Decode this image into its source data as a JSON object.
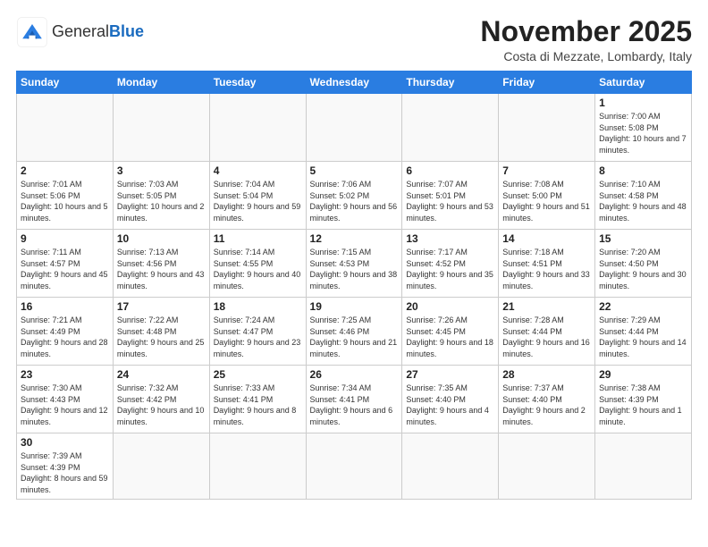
{
  "header": {
    "logo": {
      "general": "General",
      "blue": "Blue"
    },
    "title": "November 2025",
    "location": "Costa di Mezzate, Lombardy, Italy"
  },
  "days_of_week": [
    "Sunday",
    "Monday",
    "Tuesday",
    "Wednesday",
    "Thursday",
    "Friday",
    "Saturday"
  ],
  "weeks": [
    [
      {
        "day": "",
        "info": ""
      },
      {
        "day": "",
        "info": ""
      },
      {
        "day": "",
        "info": ""
      },
      {
        "day": "",
        "info": ""
      },
      {
        "day": "",
        "info": ""
      },
      {
        "day": "",
        "info": ""
      },
      {
        "day": "1",
        "info": "Sunrise: 7:00 AM\nSunset: 5:08 PM\nDaylight: 10 hours and 7 minutes."
      }
    ],
    [
      {
        "day": "2",
        "info": "Sunrise: 7:01 AM\nSunset: 5:06 PM\nDaylight: 10 hours and 5 minutes."
      },
      {
        "day": "3",
        "info": "Sunrise: 7:03 AM\nSunset: 5:05 PM\nDaylight: 10 hours and 2 minutes."
      },
      {
        "day": "4",
        "info": "Sunrise: 7:04 AM\nSunset: 5:04 PM\nDaylight: 9 hours and 59 minutes."
      },
      {
        "day": "5",
        "info": "Sunrise: 7:06 AM\nSunset: 5:02 PM\nDaylight: 9 hours and 56 minutes."
      },
      {
        "day": "6",
        "info": "Sunrise: 7:07 AM\nSunset: 5:01 PM\nDaylight: 9 hours and 53 minutes."
      },
      {
        "day": "7",
        "info": "Sunrise: 7:08 AM\nSunset: 5:00 PM\nDaylight: 9 hours and 51 minutes."
      },
      {
        "day": "8",
        "info": "Sunrise: 7:10 AM\nSunset: 4:58 PM\nDaylight: 9 hours and 48 minutes."
      }
    ],
    [
      {
        "day": "9",
        "info": "Sunrise: 7:11 AM\nSunset: 4:57 PM\nDaylight: 9 hours and 45 minutes."
      },
      {
        "day": "10",
        "info": "Sunrise: 7:13 AM\nSunset: 4:56 PM\nDaylight: 9 hours and 43 minutes."
      },
      {
        "day": "11",
        "info": "Sunrise: 7:14 AM\nSunset: 4:55 PM\nDaylight: 9 hours and 40 minutes."
      },
      {
        "day": "12",
        "info": "Sunrise: 7:15 AM\nSunset: 4:53 PM\nDaylight: 9 hours and 38 minutes."
      },
      {
        "day": "13",
        "info": "Sunrise: 7:17 AM\nSunset: 4:52 PM\nDaylight: 9 hours and 35 minutes."
      },
      {
        "day": "14",
        "info": "Sunrise: 7:18 AM\nSunset: 4:51 PM\nDaylight: 9 hours and 33 minutes."
      },
      {
        "day": "15",
        "info": "Sunrise: 7:20 AM\nSunset: 4:50 PM\nDaylight: 9 hours and 30 minutes."
      }
    ],
    [
      {
        "day": "16",
        "info": "Sunrise: 7:21 AM\nSunset: 4:49 PM\nDaylight: 9 hours and 28 minutes."
      },
      {
        "day": "17",
        "info": "Sunrise: 7:22 AM\nSunset: 4:48 PM\nDaylight: 9 hours and 25 minutes."
      },
      {
        "day": "18",
        "info": "Sunrise: 7:24 AM\nSunset: 4:47 PM\nDaylight: 9 hours and 23 minutes."
      },
      {
        "day": "19",
        "info": "Sunrise: 7:25 AM\nSunset: 4:46 PM\nDaylight: 9 hours and 21 minutes."
      },
      {
        "day": "20",
        "info": "Sunrise: 7:26 AM\nSunset: 4:45 PM\nDaylight: 9 hours and 18 minutes."
      },
      {
        "day": "21",
        "info": "Sunrise: 7:28 AM\nSunset: 4:44 PM\nDaylight: 9 hours and 16 minutes."
      },
      {
        "day": "22",
        "info": "Sunrise: 7:29 AM\nSunset: 4:44 PM\nDaylight: 9 hours and 14 minutes."
      }
    ],
    [
      {
        "day": "23",
        "info": "Sunrise: 7:30 AM\nSunset: 4:43 PM\nDaylight: 9 hours and 12 minutes."
      },
      {
        "day": "24",
        "info": "Sunrise: 7:32 AM\nSunset: 4:42 PM\nDaylight: 9 hours and 10 minutes."
      },
      {
        "day": "25",
        "info": "Sunrise: 7:33 AM\nSunset: 4:41 PM\nDaylight: 9 hours and 8 minutes."
      },
      {
        "day": "26",
        "info": "Sunrise: 7:34 AM\nSunset: 4:41 PM\nDaylight: 9 hours and 6 minutes."
      },
      {
        "day": "27",
        "info": "Sunrise: 7:35 AM\nSunset: 4:40 PM\nDaylight: 9 hours and 4 minutes."
      },
      {
        "day": "28",
        "info": "Sunrise: 7:37 AM\nSunset: 4:40 PM\nDaylight: 9 hours and 2 minutes."
      },
      {
        "day": "29",
        "info": "Sunrise: 7:38 AM\nSunset: 4:39 PM\nDaylight: 9 hours and 1 minute."
      }
    ],
    [
      {
        "day": "30",
        "info": "Sunrise: 7:39 AM\nSunset: 4:39 PM\nDaylight: 8 hours and 59 minutes."
      },
      {
        "day": "",
        "info": ""
      },
      {
        "day": "",
        "info": ""
      },
      {
        "day": "",
        "info": ""
      },
      {
        "day": "",
        "info": ""
      },
      {
        "day": "",
        "info": ""
      },
      {
        "day": "",
        "info": ""
      }
    ]
  ]
}
